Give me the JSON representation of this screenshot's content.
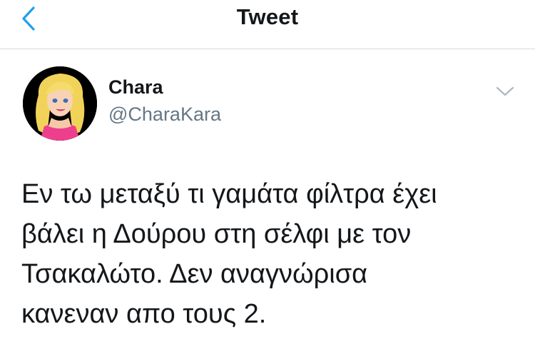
{
  "nav": {
    "title": "Tweet",
    "back_icon": "chevron-left-icon"
  },
  "tweet": {
    "author_name": "Chara",
    "author_handle": "@CharaKara",
    "avatar_icon": "avatar-cartoon-blonde-girl",
    "more_icon": "chevron-down-icon",
    "text_lines": [
      "Εν τω μεταξύ τι γαμάτα φίλτρα έχει",
      "βάλει η Δούρου στη σέλφι με τον",
      "Τσακαλώτο. Δεν αναγνώρισα",
      "κανεναν απο τους 2."
    ]
  },
  "colors": {
    "accent": "#1da1f2",
    "handle": "#657786",
    "text": "#14171a",
    "divider": "#d6d9dc"
  }
}
